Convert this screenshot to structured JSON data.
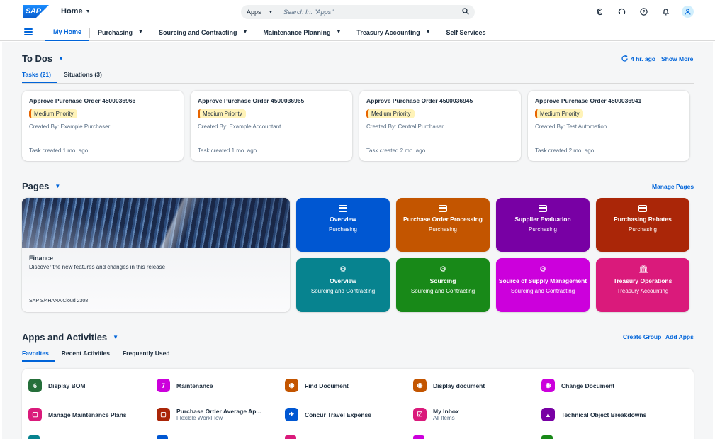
{
  "shell": {
    "logo_text": "SAP",
    "home_label": "Home",
    "search_scope": "Apps",
    "search_placeholder": "Search In: \"Apps\"",
    "icons": [
      "copilot-icon",
      "help-headset-icon",
      "help-icon",
      "notification-icon",
      "user-avatar-icon"
    ]
  },
  "nav": {
    "items": [
      {
        "label": "My Home",
        "active": true,
        "has_menu": false
      },
      {
        "label": "Purchasing",
        "active": false,
        "has_menu": true
      },
      {
        "label": "Sourcing and Contracting",
        "active": false,
        "has_menu": true
      },
      {
        "label": "Maintenance Planning",
        "active": false,
        "has_menu": true
      },
      {
        "label": "Treasury Accounting",
        "active": false,
        "has_menu": true
      },
      {
        "label": "Self Services",
        "active": false,
        "has_menu": false
      }
    ]
  },
  "todos": {
    "title": "To Dos",
    "refresh_label": "4 hr. ago",
    "show_more": "Show More",
    "tabs": [
      "Tasks (21)",
      "Situations (3)"
    ],
    "cards": [
      {
        "title": "Approve Purchase Order 4500036966",
        "priority": "Medium Priority",
        "created_by": "Created By: Example Purchaser",
        "time": "Task created 1 mo. ago"
      },
      {
        "title": "Approve Purchase Order 4500036965",
        "priority": "Medium Priority",
        "created_by": "Created By: Example Accountant",
        "time": "Task created 1 mo. ago"
      },
      {
        "title": "Approve Purchase Order 4500036945",
        "priority": "Medium Priority",
        "created_by": "Created By: Central Purchaser",
        "time": "Task created 2 mo. ago"
      },
      {
        "title": "Approve Purchase Order 4500036941",
        "priority": "Medium Priority",
        "created_by": "Created By: Test Automation",
        "time": "Task created 2 mo. ago"
      }
    ]
  },
  "pages": {
    "title": "Pages",
    "manage": "Manage Pages",
    "hero": {
      "title": "Finance",
      "desc": "Discover the new features and changes in this release",
      "footer": "SAP S/4HANA Cloud 2308"
    },
    "tiles": [
      {
        "title": "Overview",
        "subtitle": "Purchasing",
        "color": "#0057d2",
        "icon": "card-icon"
      },
      {
        "title": "Purchase Order Processing",
        "subtitle": "Purchasing",
        "color": "#c35500",
        "icon": "card-icon"
      },
      {
        "title": "Supplier Evaluation",
        "subtitle": "Purchasing",
        "color": "#7800a4",
        "icon": "card-icon"
      },
      {
        "title": "Purchasing Rebates",
        "subtitle": "Purchasing",
        "color": "#aa2608",
        "icon": "card-icon"
      },
      {
        "title": "Overview",
        "subtitle": "Sourcing and Contracting",
        "color": "#07838f",
        "icon": "sourcing-icon"
      },
      {
        "title": "Sourcing",
        "subtitle": "Sourcing and Contracting",
        "color": "#188918",
        "icon": "sourcing-icon"
      },
      {
        "title": "Source of Supply Management",
        "subtitle": "Sourcing and Contracting",
        "color": "#cc00dc",
        "icon": "sourcing-icon"
      },
      {
        "title": "Treasury Operations",
        "subtitle": "Treasury Accounting",
        "color": "#da1a7b",
        "icon": "bank-icon"
      }
    ]
  },
  "apps": {
    "title": "Apps and Activities",
    "create_group": "Create Group",
    "add_apps": "Add Apps",
    "tabs": [
      "Favorites",
      "Recent Activities",
      "Frequently Used"
    ],
    "items": [
      {
        "name": "Display BOM",
        "sub": "",
        "icon_text": "6",
        "color": "#256f3a"
      },
      {
        "name": "Maintenance",
        "sub": "",
        "icon_text": "7",
        "color": "#cc00dc"
      },
      {
        "name": "Find Document",
        "sub": "",
        "icon_text": "◉",
        "color": "#c35500"
      },
      {
        "name": "Display document",
        "sub": "",
        "icon_text": "◉",
        "color": "#c35500"
      },
      {
        "name": "Change Document",
        "sub": "",
        "icon_text": "◉",
        "color": "#cc00dc"
      },
      {
        "name": "Manage Maintenance Plans",
        "sub": "",
        "icon_text": "▢",
        "color": "#da1a7b"
      },
      {
        "name": "Purchase Order Average Ap...",
        "sub": "Flexible WorkFlow",
        "icon_text": "▢",
        "color": "#aa2608"
      },
      {
        "name": "Concur Travel Expense",
        "sub": "",
        "icon_text": "✈",
        "color": "#0057d2"
      },
      {
        "name": "My Inbox",
        "sub": "All Items",
        "icon_text": "☑",
        "color": "#da1a7b"
      },
      {
        "name": "Technical Object Breakdowns",
        "sub": "",
        "icon_text": "▲",
        "color": "#7800a4"
      }
    ]
  }
}
